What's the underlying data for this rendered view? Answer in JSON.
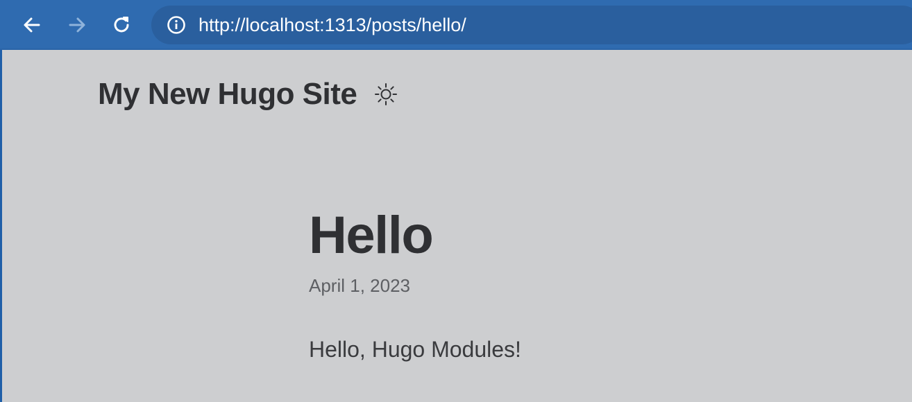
{
  "browser": {
    "url": "http://localhost:1313/posts/hello/",
    "icons": {
      "back": "back-arrow-icon",
      "forward": "forward-arrow-icon",
      "reload": "reload-icon",
      "info": "info-icon"
    },
    "colors": {
      "toolbar": "#2f6bb0",
      "omnibox": "#2a5f9e"
    }
  },
  "site": {
    "title": "My New Hugo Site",
    "theme_toggle_icon": "sun-icon"
  },
  "post": {
    "title": "Hello",
    "date": "April 1, 2023",
    "body": "Hello, Hugo Modules!"
  },
  "colors": {
    "page_background": "#cdced0",
    "text_primary": "#2f3033",
    "text_muted": "#5d5f63"
  }
}
